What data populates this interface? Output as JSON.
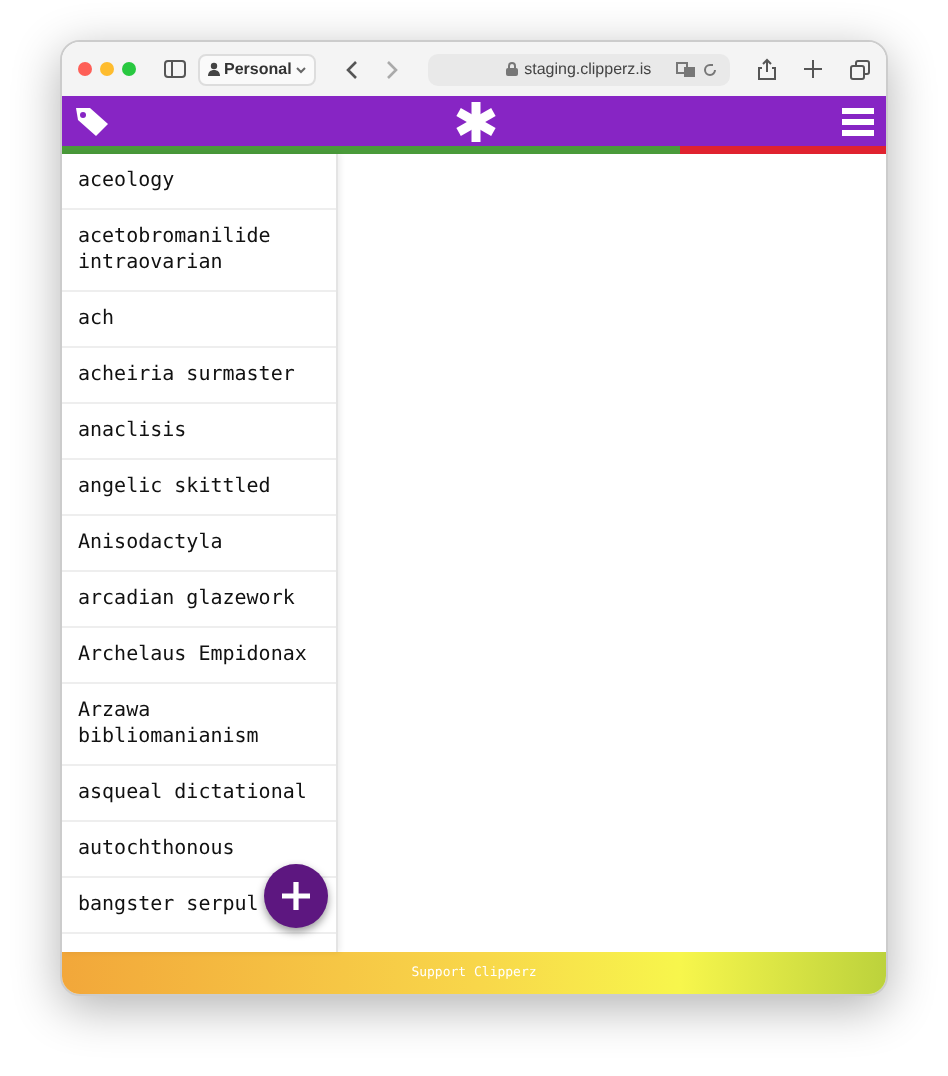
{
  "browser": {
    "profile": "Personal",
    "address": "staging.clipperz.is"
  },
  "strength_bar": {
    "level": 0.75
  },
  "cards": [
    {
      "title": "aceology"
    },
    {
      "title": "acetobromanilide intraovarian"
    },
    {
      "title": "ach"
    },
    {
      "title": "acheiria surmaster"
    },
    {
      "title": "anaclisis"
    },
    {
      "title": "angelic skittled"
    },
    {
      "title": "Anisodactyla"
    },
    {
      "title": "arcadian glazework"
    },
    {
      "title": "Archelaus Empidonax"
    },
    {
      "title": "Arzawa bibliomanianism"
    },
    {
      "title": "asqueal dictational"
    },
    {
      "title": "autochthonous"
    },
    {
      "title": "bangster serpul"
    }
  ],
  "footer": {
    "link": "Support Clipperz"
  }
}
